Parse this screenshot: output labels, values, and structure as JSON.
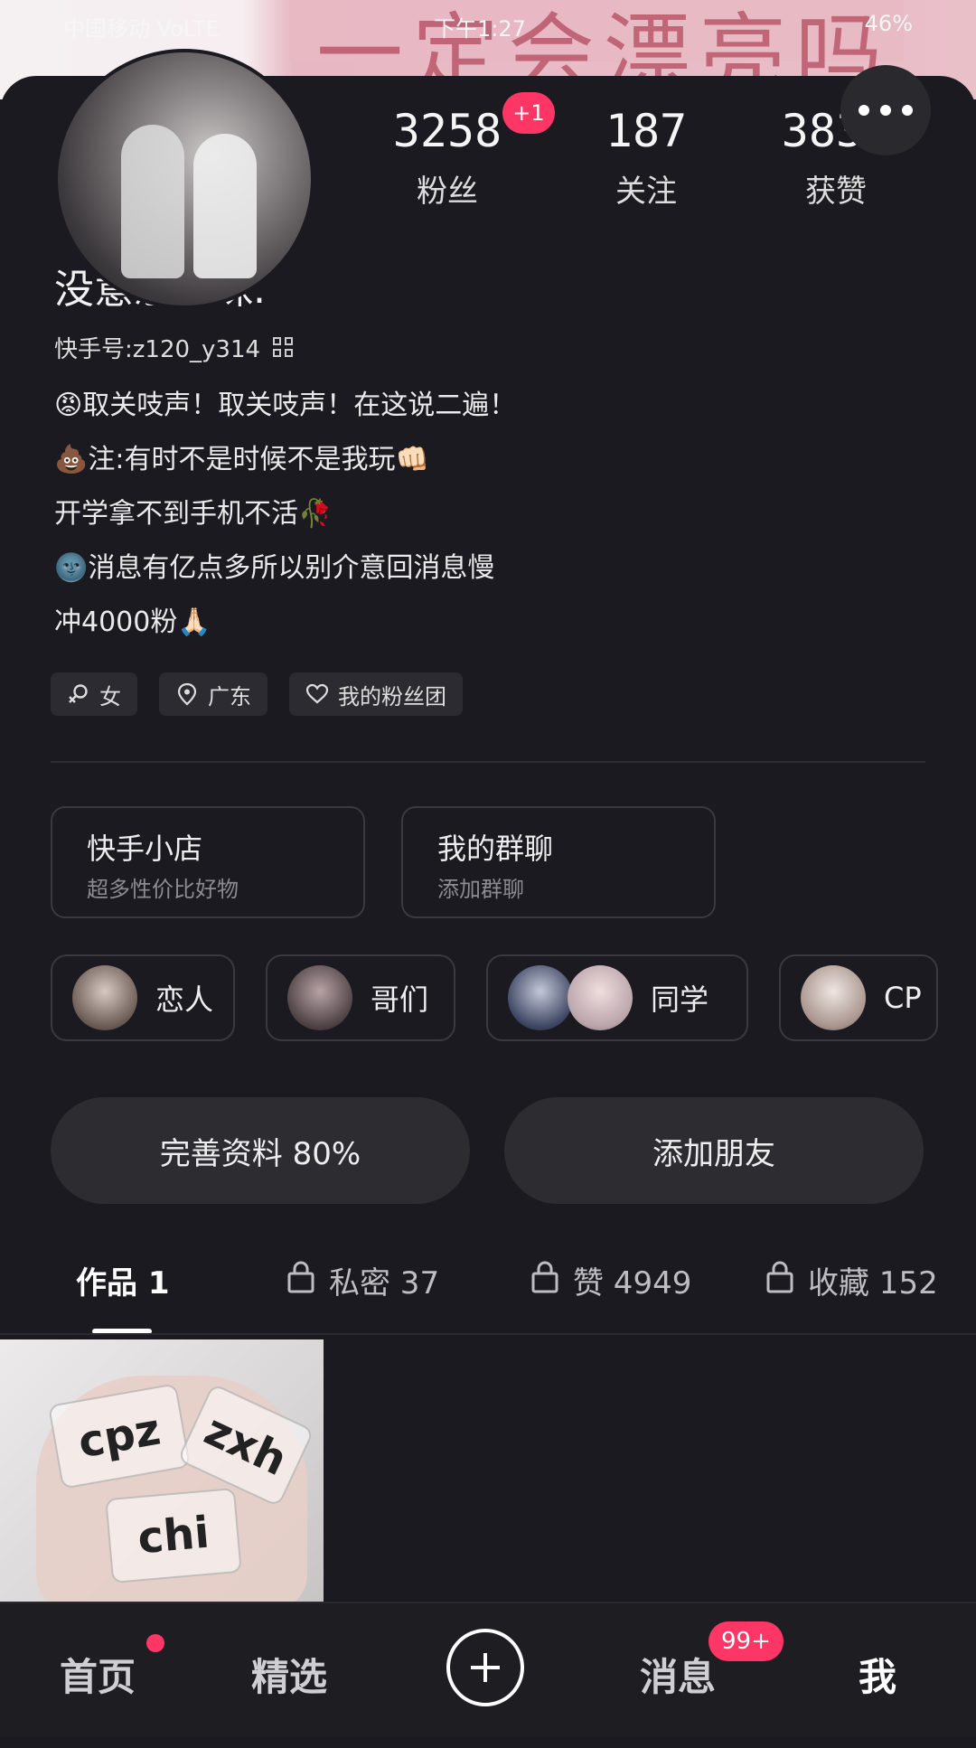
{
  "status": {
    "carrier": "中国移动 VoLTE",
    "time": "下午1:27",
    "battery": "46%"
  },
  "banner": {
    "text": "一定会漂亮吗"
  },
  "profile": {
    "stats": [
      {
        "value": "3258",
        "label": "粉丝",
        "badge": "+1"
      },
      {
        "value": "187",
        "label": "关注"
      },
      {
        "value": "3835",
        "label": "获赞"
      }
    ],
    "name": "没意思の珠.",
    "kuaishou_id": "快手号:z120_y314",
    "bio": [
      "😡取关吱声！取关吱声！在这说二遍！",
      "💩注:有时不是时候不是我玩👊🏻",
      "开学拿不到手机不活🥀",
      "🌚消息有亿点多所以别介意回消息慢",
      "冲4000粉🙏🏻"
    ],
    "tags": [
      "女",
      "广东",
      "我的粉丝团"
    ]
  },
  "shortcuts": [
    {
      "title": "快手小店",
      "subtitle": "超多性价比好物"
    },
    {
      "title": "我的群聊",
      "subtitle": "添加群聊"
    }
  ],
  "friends": [
    "恋人",
    "哥们",
    "同学",
    "CP"
  ],
  "actions": {
    "complete_profile": "完善资料 80%",
    "add_friend": "添加朋友"
  },
  "tabs": [
    {
      "label": "作品 1",
      "locked": false
    },
    {
      "label": "私密 37",
      "locked": true
    },
    {
      "label": "赞 4949",
      "locked": true
    },
    {
      "label": "收藏 152",
      "locked": true
    }
  ],
  "thumbnail_words": [
    "cpz",
    "zxh",
    "chi"
  ],
  "nav": {
    "home": "首页",
    "featured": "精选",
    "messages": "消息",
    "messages_badge": "99+",
    "me": "我"
  }
}
